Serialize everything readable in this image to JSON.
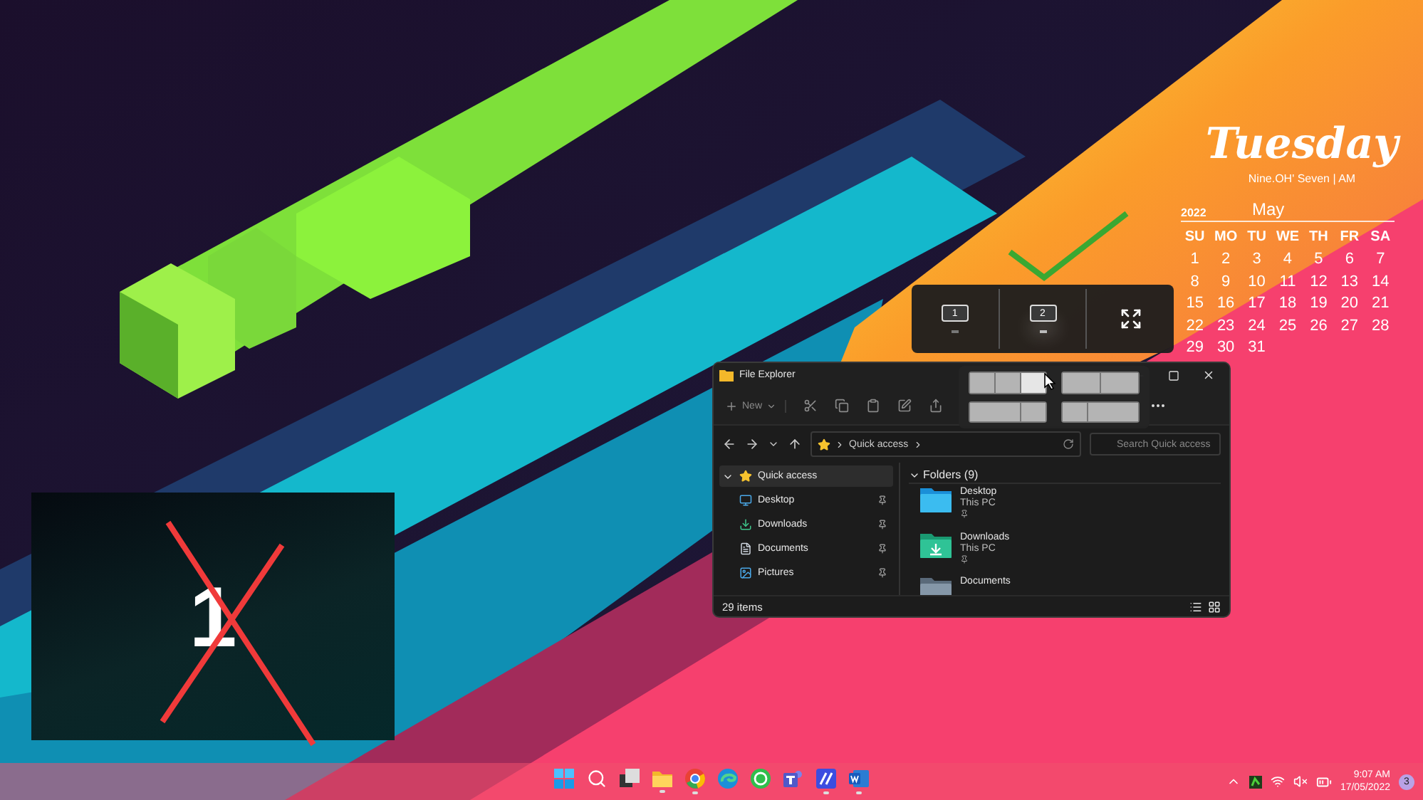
{
  "desktop_widget": {
    "day": "Tuesday",
    "time": "Nine.OH' Seven | AM",
    "year": "2022",
    "month": "May",
    "weekdays": [
      "SU",
      "MO",
      "TU",
      "WE",
      "TH",
      "FR",
      "SA"
    ],
    "dates": [
      "1",
      "2",
      "3",
      "4",
      "5",
      "6",
      "7",
      "8",
      "9",
      "10",
      "11",
      "12",
      "13",
      "14",
      "15",
      "16",
      "17",
      "18",
      "19",
      "20",
      "21",
      "22",
      "23",
      "24",
      "25",
      "26",
      "27",
      "28",
      "29",
      "30",
      "31"
    ]
  },
  "display_switcher": {
    "displays": [
      {
        "label": "1",
        "selected": false
      },
      {
        "label": "2",
        "selected": true
      }
    ]
  },
  "identify_overlay": {
    "label": "1"
  },
  "file_explorer": {
    "title": "File Explorer",
    "new_label": "New",
    "address": "Quick access",
    "search": {
      "placeholder": "Search Quick access"
    },
    "sidebar": {
      "items": [
        {
          "label": "Quick access",
          "selected": true,
          "expanded": true,
          "children": [
            {
              "label": "Desktop",
              "kind": "desktop",
              "pinned": true
            },
            {
              "label": "Downloads",
              "kind": "downloads",
              "pinned": true
            },
            {
              "label": "Documents",
              "kind": "documents",
              "pinned": true
            },
            {
              "label": "Pictures",
              "kind": "pictures",
              "pinned": true
            }
          ]
        }
      ]
    },
    "section": {
      "title": "Folders (9)",
      "expanded": true
    },
    "folders": [
      {
        "name": "Desktop",
        "location": "This PC",
        "kind": "desktop",
        "pinned": true
      },
      {
        "name": "Downloads",
        "location": "This PC",
        "kind": "downloads",
        "pinned": true
      },
      {
        "name": "Documents",
        "kind": "documents",
        "pinned": false
      }
    ],
    "status": "29 items"
  },
  "snap_layouts": [
    {
      "kind": "thirds",
      "zones": [
        {
          "selected": false
        },
        {
          "selected": false
        },
        {
          "selected": true
        }
      ]
    },
    {
      "kind": "halves",
      "zones": [
        {
          "selected": false
        },
        {
          "selected": false
        }
      ]
    },
    {
      "kind": "wide-left",
      "zones": [
        {
          "selected": false
        },
        {
          "selected": false
        }
      ]
    },
    {
      "kind": "wide-right",
      "zones": [
        {
          "selected": false
        },
        {
          "selected": false
        }
      ]
    }
  ],
  "taskbar": {
    "apps": [
      {
        "kind": "start",
        "running": false
      },
      {
        "kind": "search",
        "running": false
      },
      {
        "kind": "task-view",
        "running": false
      },
      {
        "kind": "explorer",
        "running": true
      },
      {
        "kind": "chrome",
        "running": true
      },
      {
        "kind": "edge",
        "running": false
      },
      {
        "kind": "whatsapp",
        "running": false
      },
      {
        "kind": "teams",
        "running": false
      },
      {
        "kind": "notes",
        "running": true
      },
      {
        "kind": "word",
        "running": true
      }
    ],
    "tray": {
      "time": "9:07 AM",
      "date": "17/05/2022",
      "notifications": "3"
    }
  }
}
